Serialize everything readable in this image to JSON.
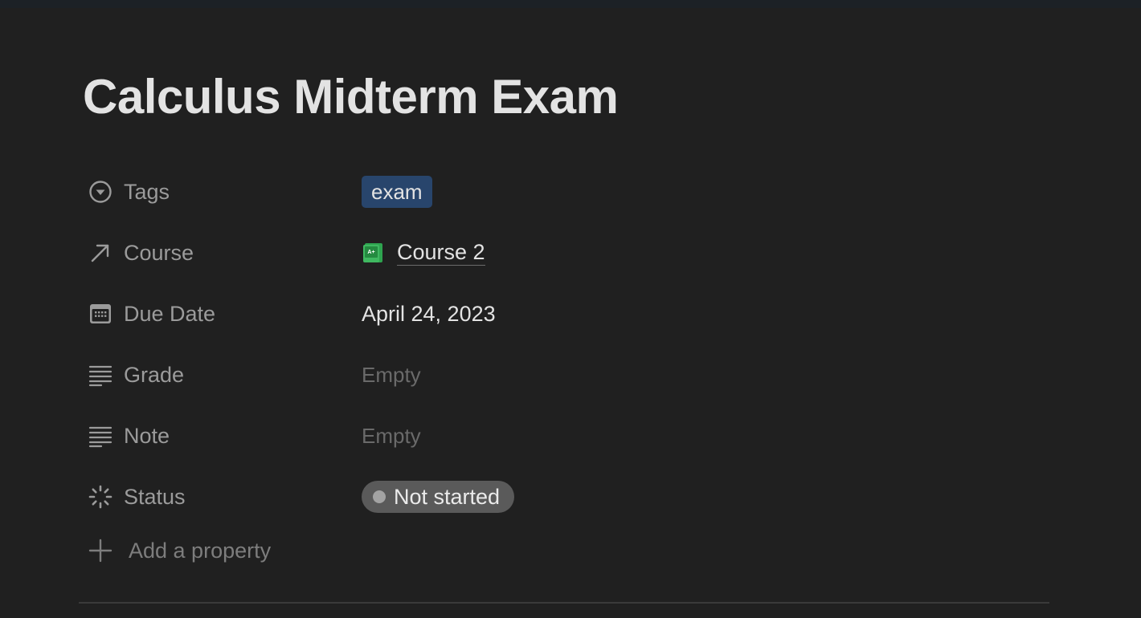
{
  "page": {
    "title": "Calculus Midterm Exam"
  },
  "properties": [
    {
      "label": "Tags",
      "icon": "dropdown-circle-icon"
    },
    {
      "label": "Course",
      "icon": "relation-arrow-icon"
    },
    {
      "label": "Due Date",
      "icon": "calendar-icon"
    },
    {
      "label": "Grade",
      "icon": "text-lines-icon"
    },
    {
      "label": "Note",
      "icon": "text-lines-icon"
    },
    {
      "label": "Status",
      "icon": "status-spinner-icon"
    }
  ],
  "values": {
    "tag": "exam",
    "course": "Course 2",
    "due_date": "April 24, 2023",
    "grade": "Empty",
    "note": "Empty",
    "status": "Not started"
  },
  "add_property": {
    "label": "Add a property"
  },
  "colors": {
    "background": "#202020",
    "tag_bg": "#28456c",
    "status_bg": "#5a5a5a",
    "course_icon": "#2ea44f"
  }
}
